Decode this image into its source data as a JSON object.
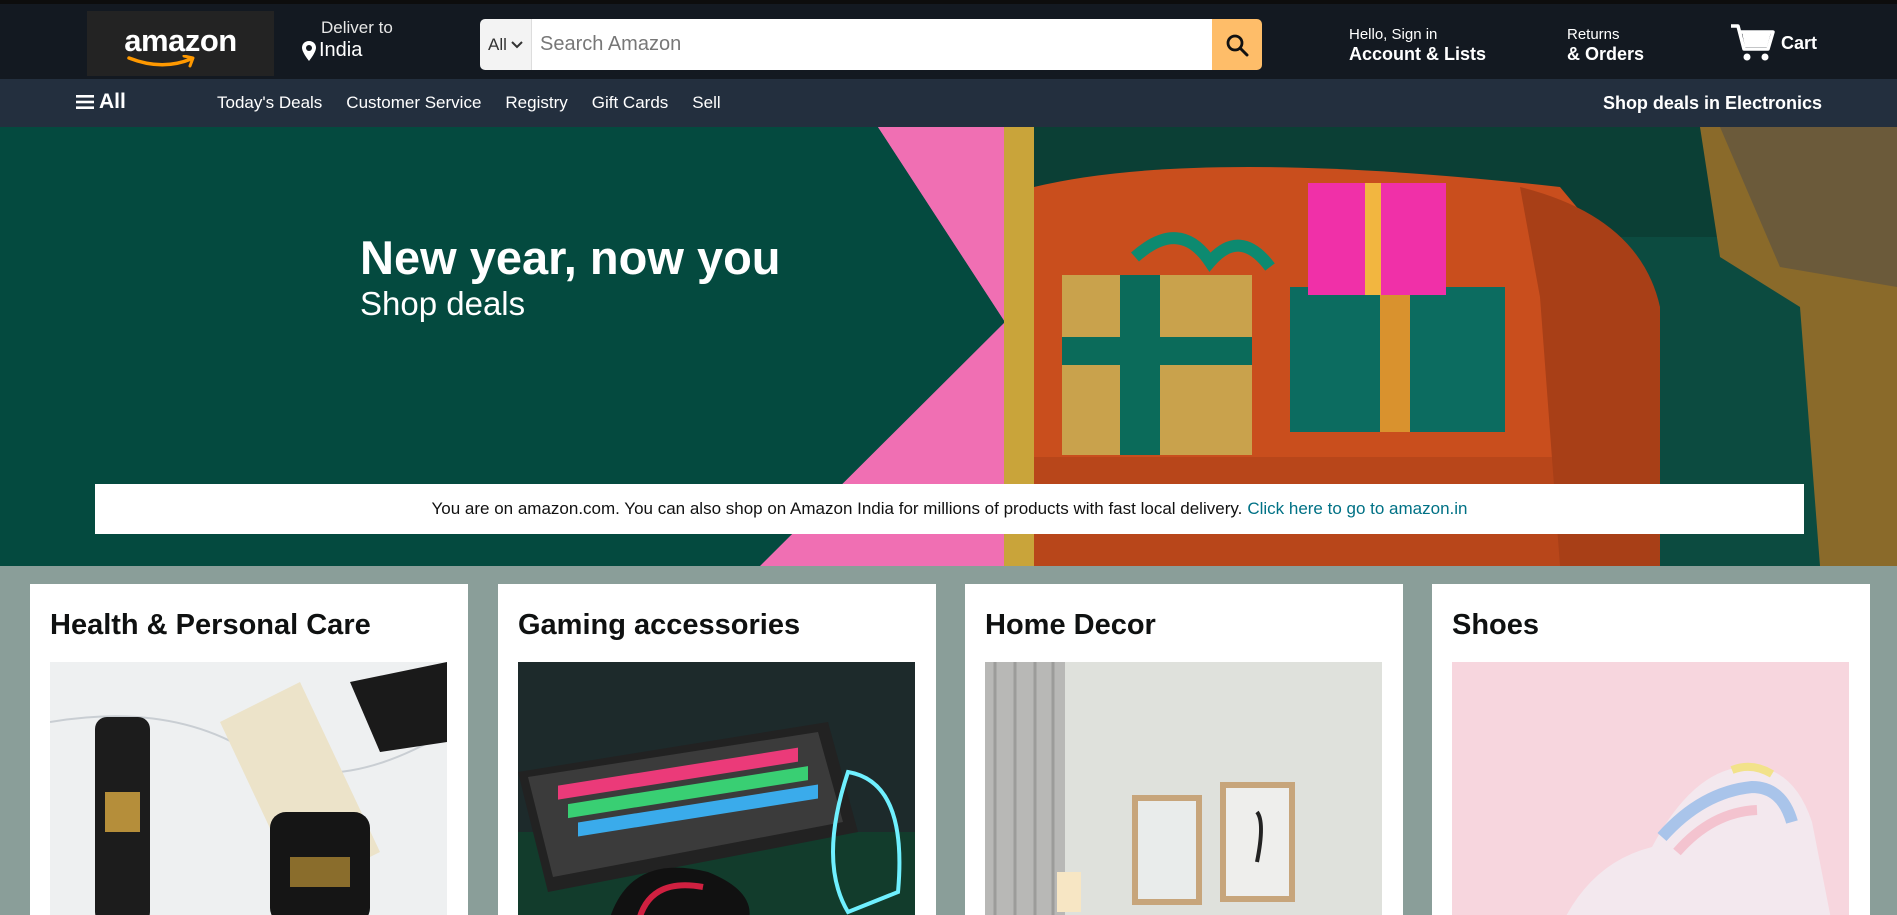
{
  "header": {
    "logo_text": "amazon",
    "deliver_line1": "Deliver to",
    "deliver_line2": "India",
    "search_category": "All",
    "search_placeholder": "Search Amazon",
    "account_line1": "Hello, Sign in",
    "account_line2": "Account & Lists",
    "returns_line1": "Returns",
    "returns_line2": "& Orders",
    "cart_label": "Cart"
  },
  "nav": {
    "all_label": "All",
    "links": [
      "Today's Deals",
      "Customer Service",
      "Registry",
      "Gift Cards",
      "Sell"
    ],
    "promo": "Shop deals in Electronics"
  },
  "hero": {
    "title": "New year, now you",
    "subtitle": "Shop deals",
    "notice_text": "You are on amazon.com. You can also shop on Amazon India for millions of products with fast local delivery.",
    "notice_link": "Click here to go to amazon.in"
  },
  "cards": [
    {
      "title": "Health & Personal Care"
    },
    {
      "title": "Gaming accessories"
    },
    {
      "title": "Home Decor"
    },
    {
      "title": "Shoes"
    }
  ],
  "colors": {
    "header_bg": "#131921",
    "nav_bg": "#232f3e",
    "search_button": "#febd69",
    "hero_green": "#044a3f",
    "hero_pink": "#f06fb3",
    "link": "#007185",
    "page_bg": "#8a9e99"
  }
}
